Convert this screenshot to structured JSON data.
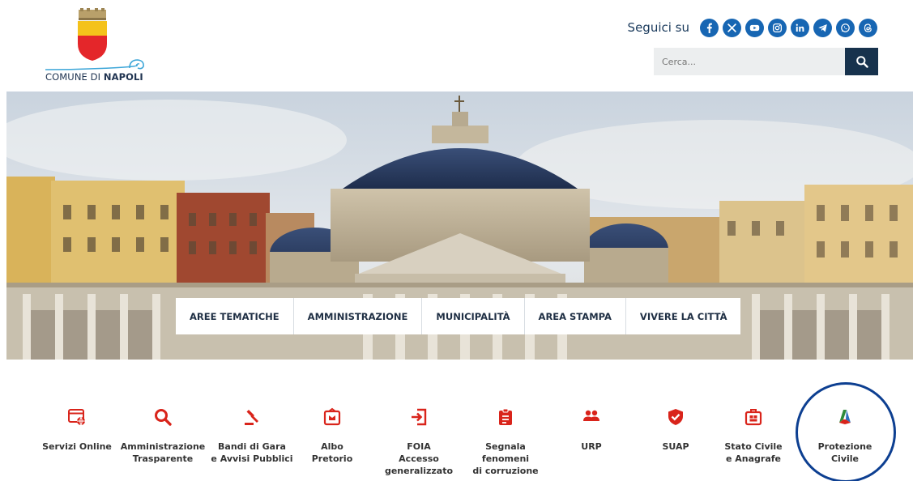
{
  "header": {
    "logo_text_plain": "COMUNE DI ",
    "logo_text_bold": "NAPOLI",
    "social_label": "Seguici su",
    "social_icons": [
      "facebook-icon",
      "x-icon",
      "youtube-icon",
      "instagram-icon",
      "linkedin-icon",
      "telegram-icon",
      "whatsapp-icon",
      "threads-icon"
    ],
    "search_placeholder": "Cerca..."
  },
  "colors": {
    "brand_blue": "#1766b3",
    "dark_navy": "#17324d",
    "icon_red": "#d9241b",
    "highlight": "#0d3f91"
  },
  "nav": {
    "items": [
      "AREE TEMATICHE",
      "AMMINISTRAZIONE",
      "MUNICIPALITÀ",
      "AREA STAMPA",
      "VIVERE LA CITTÀ"
    ]
  },
  "quick_links": [
    {
      "icon": "browser-globe-icon",
      "lines": [
        "Servizi Online"
      ]
    },
    {
      "icon": "search-icon",
      "lines": [
        "Amministrazione",
        "Trasparente"
      ]
    },
    {
      "icon": "gavel-icon",
      "lines": [
        "Bandi di Gara",
        "e Avvisi Pubblici"
      ]
    },
    {
      "icon": "notice-board-icon",
      "lines": [
        "Albo",
        "Pretorio"
      ]
    },
    {
      "icon": "login-arrow-icon",
      "lines": [
        "FOIA",
        "Accesso",
        "generalizzato"
      ]
    },
    {
      "icon": "clipboard-icon",
      "lines": [
        "Segnala",
        "fenomeni",
        "di corruzione"
      ]
    },
    {
      "icon": "people-icon",
      "lines": [
        "URP"
      ]
    },
    {
      "icon": "shield-check-icon",
      "lines": [
        "SUAP"
      ]
    },
    {
      "icon": "registry-office-icon",
      "lines": [
        "Stato Civile",
        "e Anagrafe"
      ]
    },
    {
      "icon": "civil-protection-icon",
      "lines": [
        "Protezione",
        "Civile"
      ]
    }
  ]
}
